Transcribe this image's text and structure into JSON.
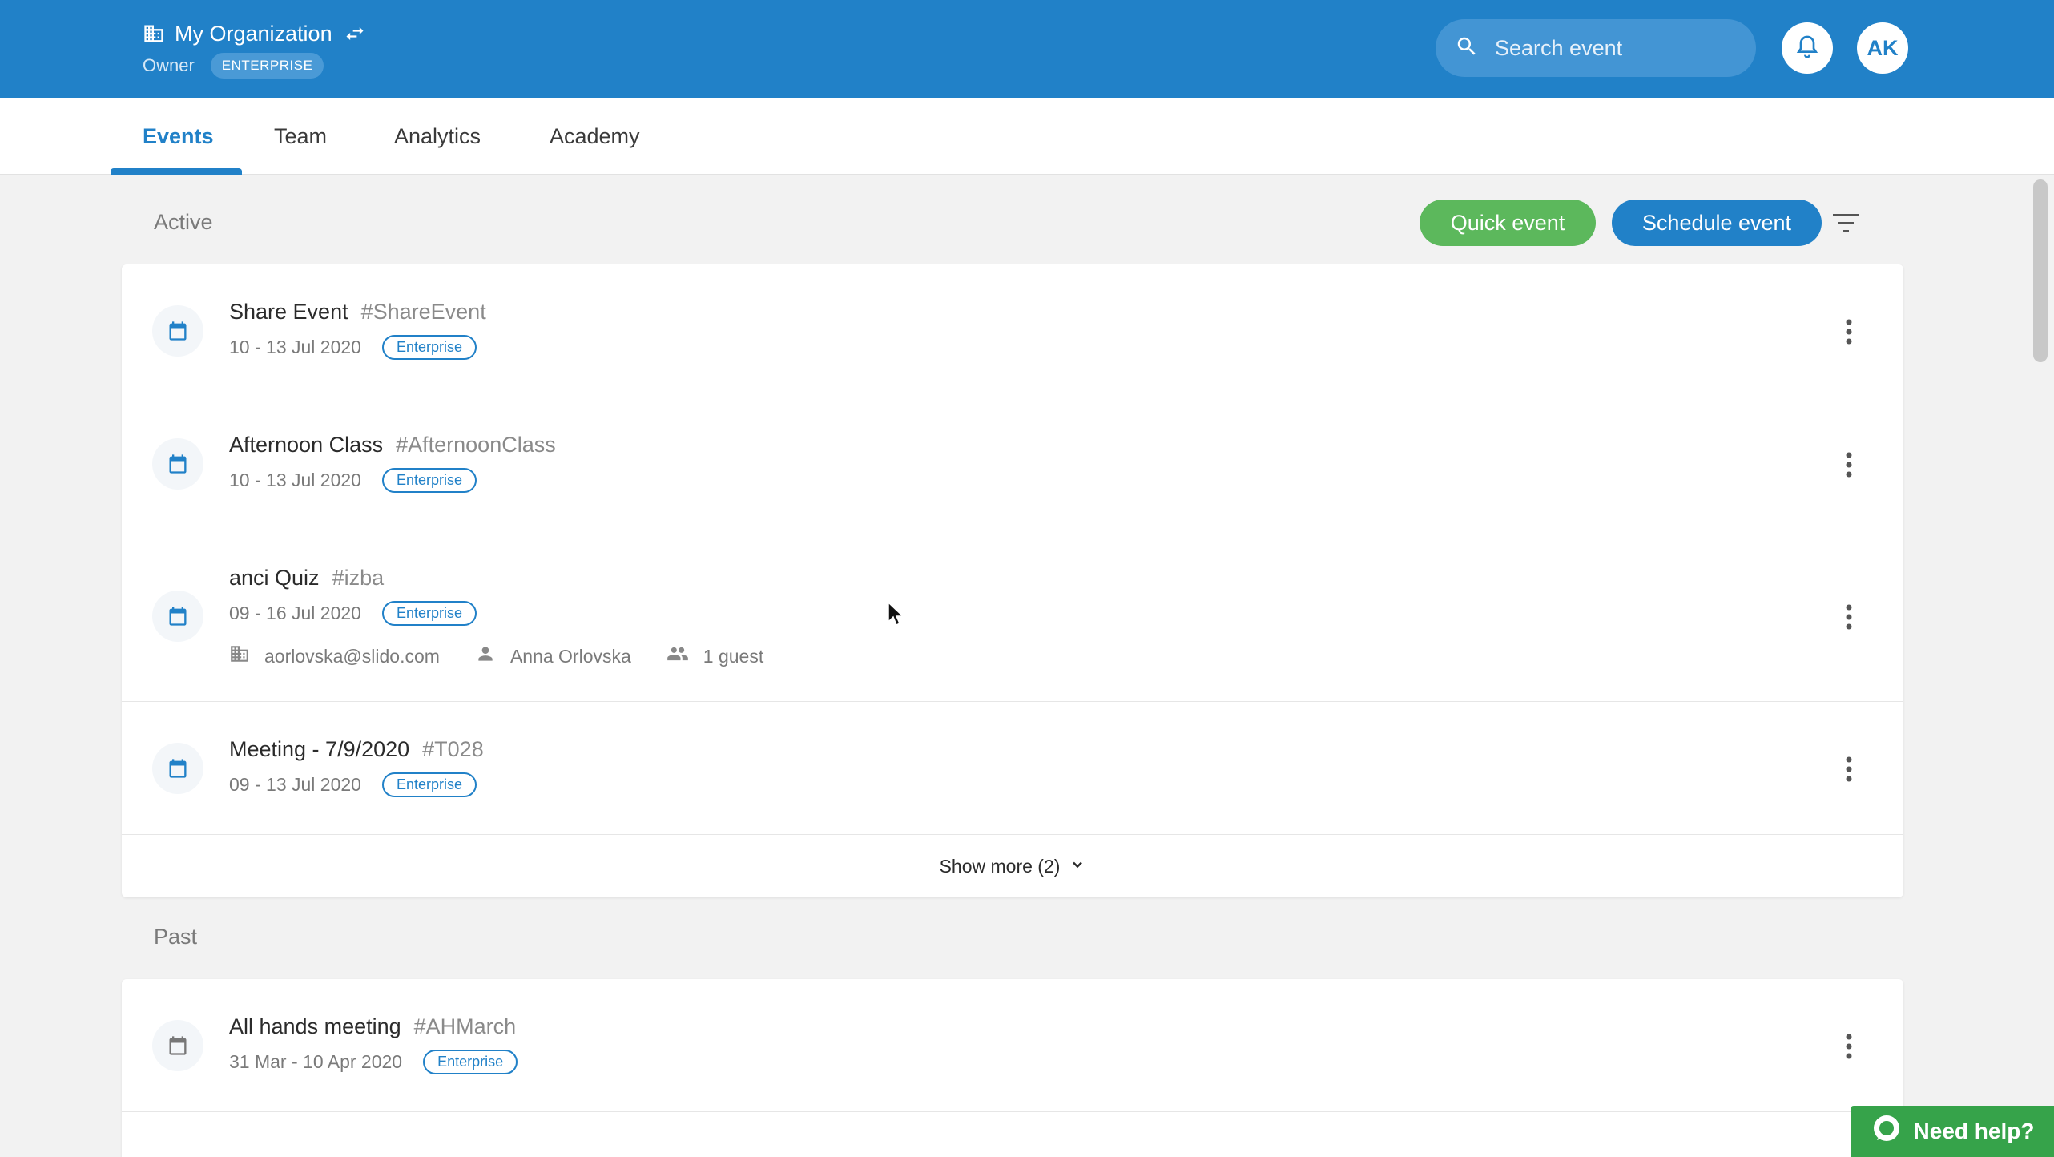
{
  "header": {
    "org_name": "My Organization",
    "role": "Owner",
    "plan": "ENTERPRISE",
    "search_placeholder": "Search event",
    "avatar_initials": "AK",
    "brand_color": "#2181c8"
  },
  "tabs": [
    {
      "label": "Events",
      "active": true
    },
    {
      "label": "Team",
      "active": false
    },
    {
      "label": "Analytics",
      "active": false
    },
    {
      "label": "Academy",
      "active": false
    }
  ],
  "active_section": {
    "title": "Active",
    "quick_event_label": "Quick event",
    "schedule_event_label": "Schedule event",
    "events": [
      {
        "title": "Share Event",
        "hashtag": "#ShareEvent",
        "date": "10 - 13 Jul 2020",
        "badge": "Enterprise"
      },
      {
        "title": "Afternoon Class",
        "hashtag": "#AfternoonClass",
        "date": "10 - 13 Jul 2020",
        "badge": "Enterprise"
      },
      {
        "title": "anci Quiz",
        "hashtag": "#izba",
        "date": "09 - 16 Jul 2020",
        "badge": "Enterprise",
        "org_email": "aorlovska@slido.com",
        "owner": "Anna Orlovska",
        "guests": "1 guest"
      },
      {
        "title": "Meeting - 7/9/2020",
        "hashtag": "#T028",
        "date": "09 - 13 Jul 2020",
        "badge": "Enterprise"
      }
    ],
    "show_more_label": "Show more (2)"
  },
  "past_section": {
    "title": "Past",
    "events": [
      {
        "title": "All hands meeting",
        "hashtag": "#AHMarch",
        "date": "31 Mar - 10 Apr 2020",
        "badge": "Enterprise"
      }
    ]
  },
  "help_label": "Need help?",
  "colors": {
    "green": "#5cb85c",
    "blue": "#2181c8",
    "help_green": "#36a34a"
  }
}
